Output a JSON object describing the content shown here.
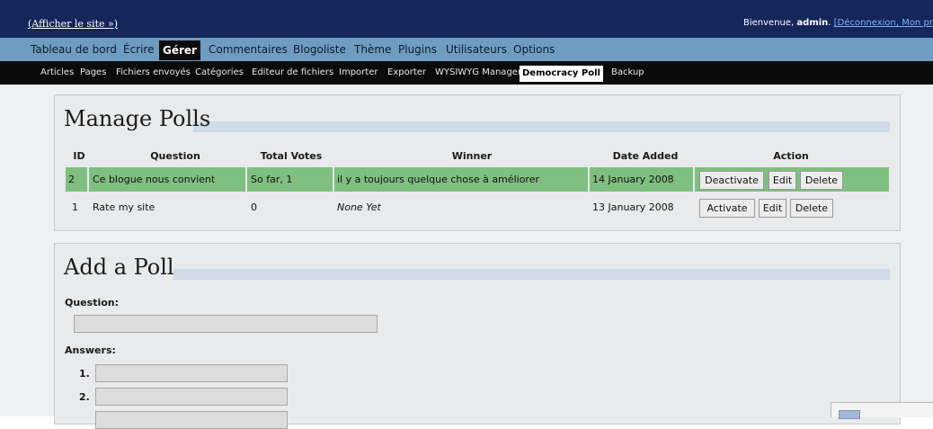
{
  "top": {
    "site_link": "(Afficher le site »)",
    "welcome_prefix": "Bienvenue,",
    "user": "admin",
    "links_text": "[Déconnexion, Mon profil]"
  },
  "main_nav": [
    "Tableau de bord",
    "Écrire",
    "Gérer",
    "Commentaires",
    "Blogoliste",
    "Thème",
    "Plugins",
    "Utilisateurs",
    "Options"
  ],
  "sub_nav": [
    "Articles",
    "Pages",
    "Fichiers envoyés",
    "Catégories",
    "Editeur de fichiers",
    "Importer",
    "Exporter",
    "WYSIWYG Manager",
    "Democracy Poll",
    "Backup"
  ],
  "manage": {
    "title": "Manage Polls",
    "columns": [
      "ID",
      "Question",
      "Total Votes",
      "Winner",
      "Date Added",
      "Action"
    ],
    "rows": [
      {
        "id": "2",
        "question": "Ce blogue nous convient",
        "votes": "So far, 1",
        "winner": "il y a toujours quelque chose à améliorer",
        "date": "14 January 2008",
        "actions": [
          "Deactivate",
          "Edit",
          "Delete"
        ]
      },
      {
        "id": "1",
        "question": "Rate my site",
        "votes": "0",
        "winner": "None Yet",
        "date": "13 January 2008",
        "actions": [
          "Activate",
          "Edit",
          "Delete"
        ]
      }
    ]
  },
  "add": {
    "title": "Add a Poll",
    "question_label": "Question:",
    "answers_label": "Answers:",
    "answer_numbers": [
      "1.",
      "2."
    ]
  }
}
